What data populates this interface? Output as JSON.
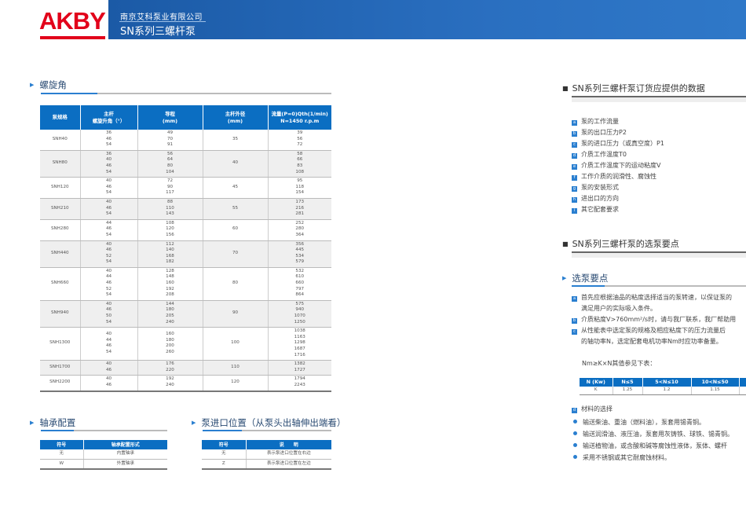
{
  "header": {
    "logo": "AKBY",
    "company": "南京艾科泵业有限公司",
    "product": "SN系列三螺杆泵"
  },
  "helix": {
    "title": "螺旋角",
    "headers": [
      "泵规格",
      "主杆\n螺旋升角（°）",
      "导程\n(mm)",
      "主杆外径\n(mm)",
      "流量(P=0)Qth(1/min)\nN=1450 r.p.m"
    ],
    "rows": [
      {
        "model": "SNH40",
        "angle": [
          "36",
          "46",
          "54"
        ],
        "lead": [
          "49",
          "70",
          "91"
        ],
        "dia": "35",
        "flow": [
          "39",
          "56",
          "72"
        ]
      },
      {
        "model": "SNH80",
        "angle": [
          "36",
          "40",
          "46",
          "54"
        ],
        "lead": [
          "56",
          "64",
          "80",
          "104"
        ],
        "dia": "40",
        "flow": [
          "58",
          "66",
          "83",
          "108"
        ]
      },
      {
        "model": "SNH120",
        "angle": [
          "40",
          "46",
          "54"
        ],
        "lead": [
          "72",
          "90",
          "117"
        ],
        "dia": "45",
        "flow": [
          "95",
          "118",
          "154"
        ]
      },
      {
        "model": "SNH210",
        "angle": [
          "40",
          "46",
          "54"
        ],
        "lead": [
          "88",
          "110",
          "143"
        ],
        "dia": "55",
        "flow": [
          "173",
          "216",
          "281"
        ]
      },
      {
        "model": "SNH280",
        "angle": [
          "44",
          "46",
          "54"
        ],
        "lead": [
          "108",
          "120",
          "156"
        ],
        "dia": "60",
        "flow": [
          "252",
          "280",
          "364"
        ]
      },
      {
        "model": "SNH440",
        "angle": [
          "40",
          "46",
          "52",
          "54"
        ],
        "lead": [
          "112",
          "140",
          "168",
          "182"
        ],
        "dia": "70",
        "flow": [
          "356",
          "445",
          "534",
          "579"
        ]
      },
      {
        "model": "SNH660",
        "angle": [
          "40",
          "44",
          "46",
          "52",
          "54"
        ],
        "lead": [
          "128",
          "148",
          "160",
          "192",
          "208"
        ],
        "dia": "80",
        "flow": [
          "532",
          "610",
          "660",
          "797",
          "864"
        ]
      },
      {
        "model": "SNH940",
        "angle": [
          "40",
          "46",
          "50",
          "54"
        ],
        "lead": [
          "144",
          "180",
          "205",
          "240"
        ],
        "dia": "90",
        "flow": [
          "575",
          "940",
          "1070",
          "1250"
        ]
      },
      {
        "model": "SNH1300",
        "angle": [
          "40",
          "44",
          "46",
          "54"
        ],
        "lead": [
          "160",
          "180",
          "200",
          "260"
        ],
        "dia": "100",
        "flow": [
          "1038",
          "1163",
          "1298",
          "1687",
          "1716"
        ]
      },
      {
        "model": "SNH1700",
        "angle": [
          "40",
          "46"
        ],
        "lead": [
          "176",
          "220"
        ],
        "dia": "110",
        "flow": [
          "1382",
          "1727"
        ]
      },
      {
        "model": "SNH2200",
        "angle": [
          "40",
          "46"
        ],
        "lead": [
          "192",
          "240"
        ],
        "dia": "120",
        "flow": [
          "1794",
          "2243"
        ]
      }
    ]
  },
  "bearing": {
    "title": "轴承配置",
    "headers": [
      "符号",
      "轴承配置形式"
    ],
    "rows": [
      [
        "无",
        "内置轴承"
      ],
      [
        "W",
        "外置轴承"
      ]
    ]
  },
  "inlet": {
    "title": "泵进口位置（从泵头出轴伸出端看）",
    "headers": [
      "符号",
      "说　　明"
    ],
    "rows": [
      [
        "无",
        "表示泵进口位置在右边"
      ],
      [
        "Z",
        "表示泵进口位置在左边"
      ]
    ]
  },
  "order": {
    "title": "SN系列三螺杆泵订货应提供的数据",
    "items": [
      {
        "b": "a",
        "t": "泵的工作流量"
      },
      {
        "b": "b",
        "t": "泵的出口压力P2"
      },
      {
        "b": "c",
        "t": "泵的进口压力（或真空度）P1"
      },
      {
        "b": "d",
        "t": "介质工作温度T0"
      },
      {
        "b": "e",
        "t": "介质工作温度下的运动粘度V"
      },
      {
        "b": "f",
        "t": "工作介质的润滑性、腐蚀性"
      },
      {
        "b": "g",
        "t": "泵的安装形式"
      },
      {
        "b": "h",
        "t": "进出口的方向"
      },
      {
        "b": "i",
        "t": "其它配套要求"
      }
    ]
  },
  "selection": {
    "title": "SN系列三螺杆泵的选泵要点",
    "subtitle": "选泵要点",
    "items": [
      {
        "b": "a",
        "lines": [
          "首先应根据油品的粘度选择适当的泵转速，以保证泵的",
          "满足用户的实际吸入条件。"
        ]
      },
      {
        "b": "b",
        "lines": [
          "介质粘度V>760mm²/s时，请与我厂联系，我厂帮助用"
        ]
      },
      {
        "b": "c",
        "lines": [
          "从性能表中选定泵的规格及相应粘度下的压力流量后",
          "的轴功率N，选定配套电机功率Nm时应功率备量。"
        ]
      }
    ],
    "formula": "Nm≥K×N其值参见下表：",
    "k_table": {
      "headers": [
        "N (Kw)",
        "N≤5",
        "5<N≤10",
        "10<N≤50",
        ""
      ],
      "row": [
        "K",
        "1.25",
        "1.2",
        "1.15",
        ""
      ]
    },
    "material": {
      "b": "d",
      "title": "材料的选择",
      "bullets": [
        "输送柴油、重油（燃料油），泵套用锡青铜。",
        "输送润滑油、液压油，泵套用灰铸铁、球铁、锡青铜。",
        "输送植物油，或含酸和碱等腐蚀性液体，泵体、螺杆",
        "采用不锈钢或其它耐腐蚀材料。"
      ]
    }
  }
}
